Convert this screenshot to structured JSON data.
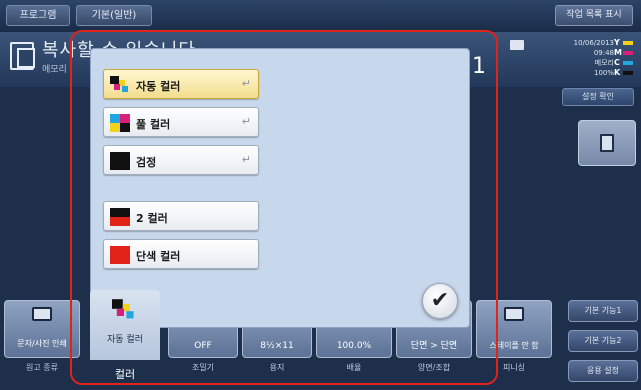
{
  "topbar": {
    "tab_program": "프로그램",
    "tab_basic": "기본(일반)",
    "job_list": "작업 목록 표시"
  },
  "status": {
    "ready_text": "복사할 수 있습니다",
    "sub_text": "메모리",
    "count": "1",
    "date": "10/06/2013",
    "time": "09:48",
    "memory": "메모리",
    "memory_pct": "100%",
    "toner": [
      {
        "label": "Y",
        "color": "#f2d21a"
      },
      {
        "label": "M",
        "color": "#d8207a"
      },
      {
        "label": "C",
        "color": "#23a6dd"
      },
      {
        "label": "K",
        "color": "#111111"
      }
    ],
    "confirm_settings": "설정 확인"
  },
  "color_dialog": {
    "options": [
      {
        "label": "자동 컬러",
        "selected": true,
        "enter": "↵"
      },
      {
        "label": "풀 컬러",
        "selected": false,
        "enter": "↵"
      },
      {
        "label": "검정",
        "selected": false,
        "enter": "↵"
      },
      {
        "label": "2 컬러",
        "selected": false,
        "enter": ""
      },
      {
        "label": "단색 컬러",
        "selected": false,
        "enter": ""
      }
    ],
    "ok_icon": "✔"
  },
  "bottom": {
    "tabs": [
      {
        "value": "문자/사진 인쇄",
        "label": "원고 종류"
      },
      {
        "value": "자동 컬러",
        "label": "컬러"
      },
      {
        "value": "OFF",
        "label": "조밀기"
      },
      {
        "value": "8½×11",
        "label": "용지"
      },
      {
        "value": "100.0%",
        "label": "배율"
      },
      {
        "value": "단면 > 단면",
        "label": "양면/조합"
      },
      {
        "value": "스테이플 안 함",
        "label": "피니싱"
      }
    ]
  },
  "right_functions": {
    "basic1": "기본 기능1",
    "basic2": "기본 기능2",
    "app": "응용 설정"
  }
}
